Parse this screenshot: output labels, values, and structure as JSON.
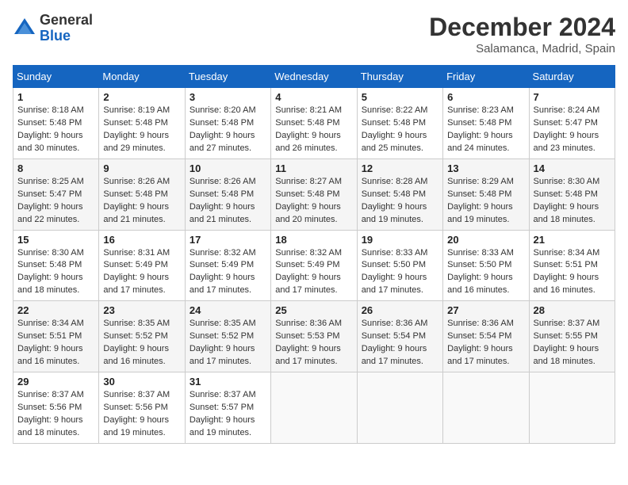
{
  "header": {
    "logo_general": "General",
    "logo_blue": "Blue",
    "month_title": "December 2024",
    "location": "Salamanca, Madrid, Spain"
  },
  "calendar": {
    "days_of_week": [
      "Sunday",
      "Monday",
      "Tuesday",
      "Wednesday",
      "Thursday",
      "Friday",
      "Saturday"
    ],
    "weeks": [
      [
        {
          "day": "1",
          "sunrise": "8:18 AM",
          "sunset": "5:48 PM",
          "daylight": "9 hours and 30 minutes."
        },
        {
          "day": "2",
          "sunrise": "8:19 AM",
          "sunset": "5:48 PM",
          "daylight": "9 hours and 29 minutes."
        },
        {
          "day": "3",
          "sunrise": "8:20 AM",
          "sunset": "5:48 PM",
          "daylight": "9 hours and 27 minutes."
        },
        {
          "day": "4",
          "sunrise": "8:21 AM",
          "sunset": "5:48 PM",
          "daylight": "9 hours and 26 minutes."
        },
        {
          "day": "5",
          "sunrise": "8:22 AM",
          "sunset": "5:48 PM",
          "daylight": "9 hours and 25 minutes."
        },
        {
          "day": "6",
          "sunrise": "8:23 AM",
          "sunset": "5:48 PM",
          "daylight": "9 hours and 24 minutes."
        },
        {
          "day": "7",
          "sunrise": "8:24 AM",
          "sunset": "5:47 PM",
          "daylight": "9 hours and 23 minutes."
        }
      ],
      [
        {
          "day": "8",
          "sunrise": "8:25 AM",
          "sunset": "5:47 PM",
          "daylight": "9 hours and 22 minutes."
        },
        {
          "day": "9",
          "sunrise": "8:26 AM",
          "sunset": "5:48 PM",
          "daylight": "9 hours and 21 minutes."
        },
        {
          "day": "10",
          "sunrise": "8:26 AM",
          "sunset": "5:48 PM",
          "daylight": "9 hours and 21 minutes."
        },
        {
          "day": "11",
          "sunrise": "8:27 AM",
          "sunset": "5:48 PM",
          "daylight": "9 hours and 20 minutes."
        },
        {
          "day": "12",
          "sunrise": "8:28 AM",
          "sunset": "5:48 PM",
          "daylight": "9 hours and 19 minutes."
        },
        {
          "day": "13",
          "sunrise": "8:29 AM",
          "sunset": "5:48 PM",
          "daylight": "9 hours and 19 minutes."
        },
        {
          "day": "14",
          "sunrise": "8:30 AM",
          "sunset": "5:48 PM",
          "daylight": "9 hours and 18 minutes."
        }
      ],
      [
        {
          "day": "15",
          "sunrise": "8:30 AM",
          "sunset": "5:48 PM",
          "daylight": "9 hours and 18 minutes."
        },
        {
          "day": "16",
          "sunrise": "8:31 AM",
          "sunset": "5:49 PM",
          "daylight": "9 hours and 17 minutes."
        },
        {
          "day": "17",
          "sunrise": "8:32 AM",
          "sunset": "5:49 PM",
          "daylight": "9 hours and 17 minutes."
        },
        {
          "day": "18",
          "sunrise": "8:32 AM",
          "sunset": "5:49 PM",
          "daylight": "9 hours and 17 minutes."
        },
        {
          "day": "19",
          "sunrise": "8:33 AM",
          "sunset": "5:50 PM",
          "daylight": "9 hours and 17 minutes."
        },
        {
          "day": "20",
          "sunrise": "8:33 AM",
          "sunset": "5:50 PM",
          "daylight": "9 hours and 16 minutes."
        },
        {
          "day": "21",
          "sunrise": "8:34 AM",
          "sunset": "5:51 PM",
          "daylight": "9 hours and 16 minutes."
        }
      ],
      [
        {
          "day": "22",
          "sunrise": "8:34 AM",
          "sunset": "5:51 PM",
          "daylight": "9 hours and 16 minutes."
        },
        {
          "day": "23",
          "sunrise": "8:35 AM",
          "sunset": "5:52 PM",
          "daylight": "9 hours and 16 minutes."
        },
        {
          "day": "24",
          "sunrise": "8:35 AM",
          "sunset": "5:52 PM",
          "daylight": "9 hours and 17 minutes."
        },
        {
          "day": "25",
          "sunrise": "8:36 AM",
          "sunset": "5:53 PM",
          "daylight": "9 hours and 17 minutes."
        },
        {
          "day": "26",
          "sunrise": "8:36 AM",
          "sunset": "5:54 PM",
          "daylight": "9 hours and 17 minutes."
        },
        {
          "day": "27",
          "sunrise": "8:36 AM",
          "sunset": "5:54 PM",
          "daylight": "9 hours and 17 minutes."
        },
        {
          "day": "28",
          "sunrise": "8:37 AM",
          "sunset": "5:55 PM",
          "daylight": "9 hours and 18 minutes."
        }
      ],
      [
        {
          "day": "29",
          "sunrise": "8:37 AM",
          "sunset": "5:56 PM",
          "daylight": "9 hours and 18 minutes."
        },
        {
          "day": "30",
          "sunrise": "8:37 AM",
          "sunset": "5:56 PM",
          "daylight": "9 hours and 19 minutes."
        },
        {
          "day": "31",
          "sunrise": "8:37 AM",
          "sunset": "5:57 PM",
          "daylight": "9 hours and 19 minutes."
        },
        null,
        null,
        null,
        null
      ]
    ]
  }
}
